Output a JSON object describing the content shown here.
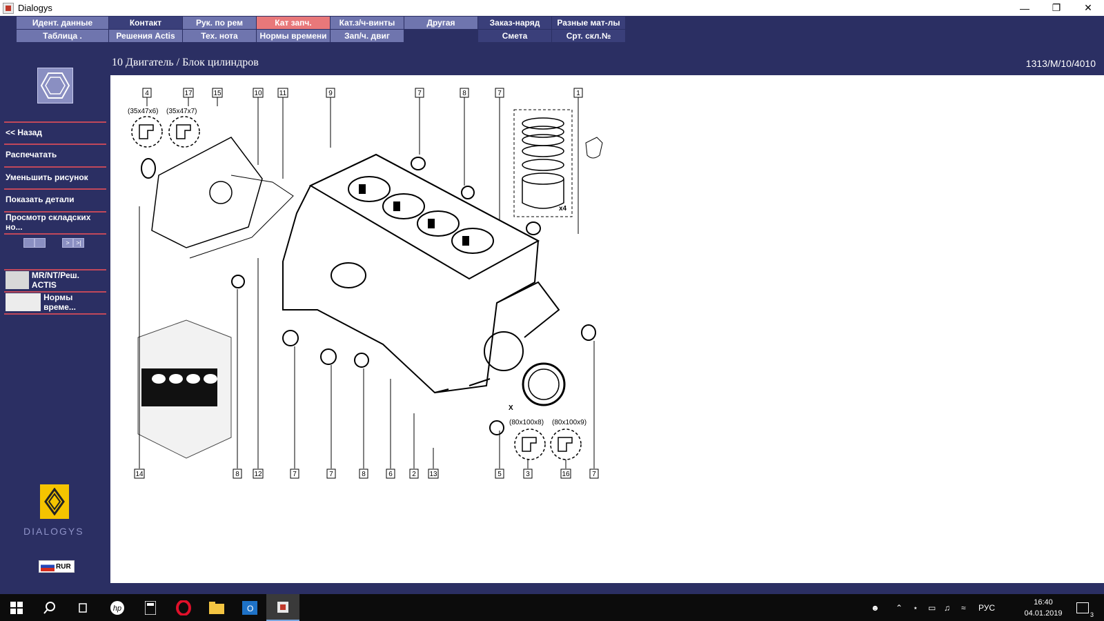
{
  "window": {
    "title": "Dialogys"
  },
  "nav": {
    "row1": [
      "Идент. данные",
      "Контакт",
      "Рук. по рем",
      "Кат запч.",
      "Кат.з/ч-винты",
      "Другая",
      "Заказ-наряд",
      "Разные мат-лы"
    ],
    "row2": [
      "Таблица .",
      "Решения Actis",
      "Тех. нота",
      "Нормы времени",
      "Зап/ч. двиг",
      "Смета",
      "Срт. скл.№"
    ]
  },
  "header": {
    "title": "10 Двигатель / Блок цилиндров",
    "ref": "1313/M/10/4010"
  },
  "sidebar": {
    "items": [
      "<< Назад",
      "Распечатать",
      "Уменьшить рисунок",
      "Показать детали",
      "Просмотр складских но..."
    ],
    "pager": [
      "",
      "",
      ">",
      ">|"
    ],
    "tools": [
      "MR/NT/Реш. ACTIS",
      "Нормы време..."
    ],
    "brand": "DIALOGYS",
    "currency": "RUR"
  },
  "diagram": {
    "callouts_top": [
      "4",
      "17",
      "15",
      "10",
      "11",
      "9",
      "7",
      "8",
      "7",
      "1"
    ],
    "callouts_bottom": [
      "14",
      "8",
      "12",
      "7",
      "7",
      "8",
      "6",
      "2",
      "13",
      "5",
      "3",
      "16",
      "7"
    ],
    "seal_labels": [
      "(35x47x6)",
      "(35x47x7)",
      "(80x100x8)",
      "(80x100x9)"
    ],
    "multiplier": "x4",
    "mark_x": "X"
  },
  "taskbar": {
    "lang": "РУС",
    "time": "16:40",
    "date": "04.01.2019",
    "notifications": "3"
  }
}
